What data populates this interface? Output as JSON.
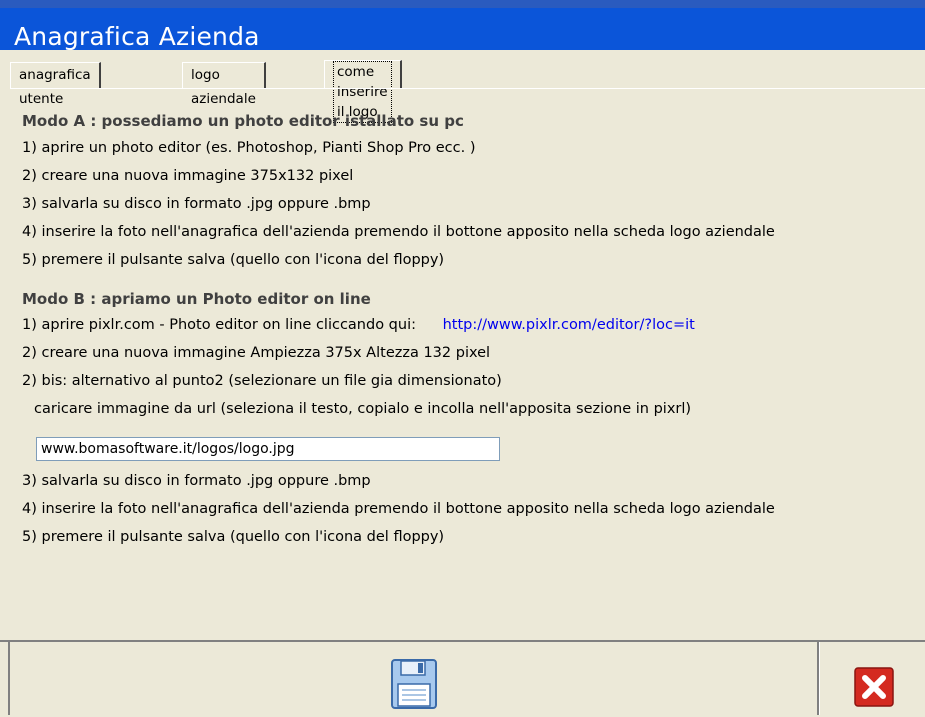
{
  "window": {
    "title": "Anagrafica Azienda"
  },
  "tabs": [
    {
      "label": "anagrafica utente"
    },
    {
      "label": "logo aziendale"
    },
    {
      "label": "come inserire il logo"
    }
  ],
  "mode_a": {
    "heading": "Modo A : possediamo un photo editor istallato su pc",
    "steps": [
      "1) aprire un photo editor (es. Photoshop, Pianti Shop Pro ecc. )",
      "2) creare una nuova immagine 375x132 pixel",
      "3) salvarla su disco in formato .jpg oppure .bmp",
      "4) inserire la foto nell'anagrafica dell'azienda premendo il bottone apposito nella scheda logo aziendale",
      "5) premere il pulsante salva (quello con l'icona del floppy)"
    ]
  },
  "mode_b": {
    "heading": "Modo B : apriamo un Photo editor on line",
    "step1": "1) aprire pixlr.com - Photo editor on line cliccando qui:",
    "link": "http://www.pixlr.com/editor/?loc=it",
    "step2": "2) creare una nuova immagine Ampiezza 375x Altezza 132  pixel",
    "step2bis": "2) bis: alternativo al punto2 (selezionare un file gia dimensionato)",
    "step2bis_detail": "caricare immagine da url (seleziona il testo, copialo e incolla nell'apposita sezione in pixrl)",
    "url_value": "www.bomasoftware.it/logos/logo.jpg",
    "step3": "3) salvarla su disco in formato .jpg oppure .bmp",
    "step4": "4) inserire la foto nell'anagrafica dell'azienda premendo il bottone apposito nella scheda logo aziendale",
    "step5": "5) premere il pulsante salva (quello con l'icona del floppy)"
  },
  "toolbar": {
    "save_icon": "floppy-disk-icon",
    "close_icon": "close-icon"
  },
  "colors": {
    "title_bar": "#0b55d9",
    "background": "#ece9d8",
    "link": "#0000ee",
    "close_button": "#d42a20"
  }
}
